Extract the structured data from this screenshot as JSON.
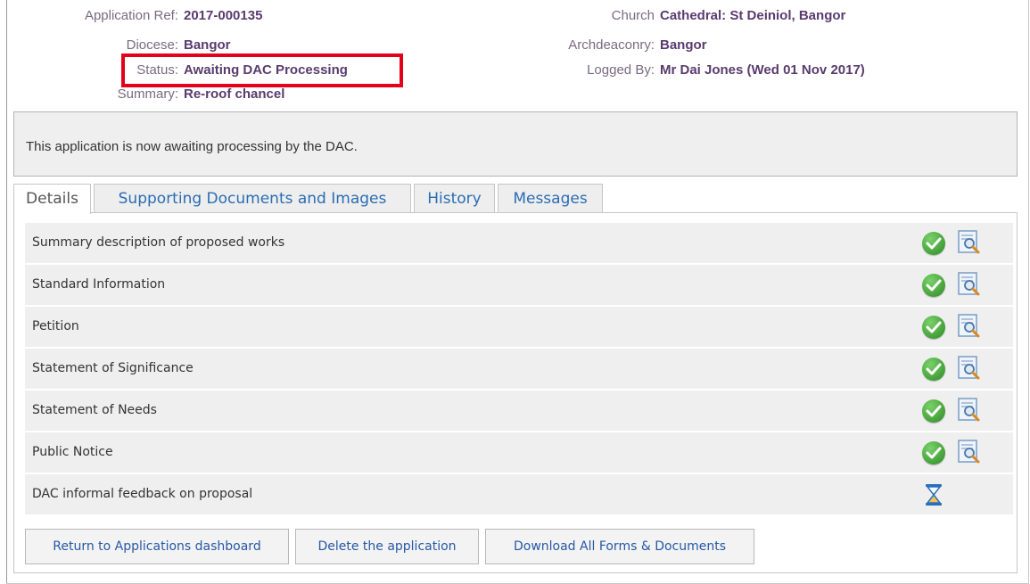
{
  "header": {
    "left": [
      {
        "label": "Application Ref:",
        "value": "2017-000135"
      },
      {
        "label": "Diocese:",
        "value": "Bangor"
      },
      {
        "label": "Status:",
        "value": "Awaiting DAC Processing"
      },
      {
        "label": "Summary:",
        "value": "Re-roof chancel"
      }
    ],
    "right": [
      {
        "label": "Church",
        "value": "Cathedral: St Deiniol, Bangor"
      },
      {
        "label": "Archdeaconry:",
        "value": "Bangor"
      },
      {
        "label": "Logged By:",
        "value": "Mr Dai Jones (Wed 01 Nov 2017)"
      }
    ]
  },
  "notice": {
    "text": "This application is now awaiting processing by the DAC."
  },
  "tabs": [
    {
      "label": "Details",
      "active": true
    },
    {
      "label": "Supporting Documents and Images",
      "active": false
    },
    {
      "label": "History",
      "active": false
    },
    {
      "label": "Messages",
      "active": false
    }
  ],
  "rows": [
    {
      "label": "Summary description of proposed works",
      "status": "complete"
    },
    {
      "label": "Standard Information",
      "status": "complete"
    },
    {
      "label": "Petition",
      "status": "complete"
    },
    {
      "label": "Statement of Significance",
      "status": "complete"
    },
    {
      "label": "Statement of Needs",
      "status": "complete"
    },
    {
      "label": "Public Notice",
      "status": "complete"
    },
    {
      "label": "DAC informal feedback on proposal",
      "status": "pending"
    }
  ],
  "buttons": {
    "return": "Return to Applications dashboard",
    "delete": "Delete the application",
    "download": "Download All Forms & Documents"
  },
  "colors": {
    "status_highlight": "#e3001b",
    "value_text": "#5a3b6e",
    "link_blue": "#2558a6",
    "check_green": "#2c8a25"
  }
}
